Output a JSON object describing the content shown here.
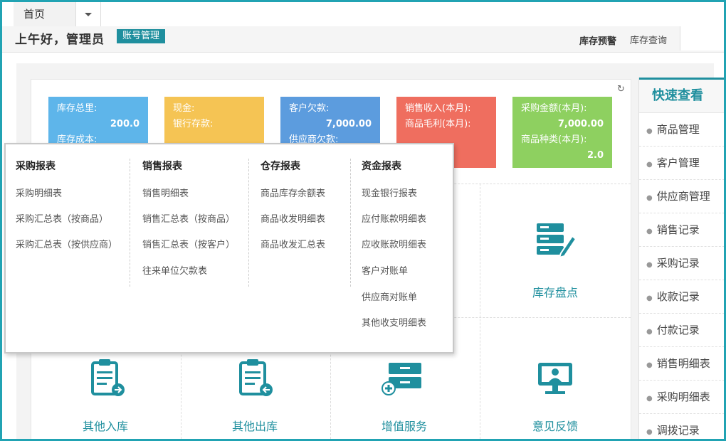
{
  "tabs": {
    "home": "首页"
  },
  "header": {
    "greeting": "上午好，管理员",
    "account_button": "账号管理",
    "stock_warning": "库存预警",
    "stock_query": "库存查询"
  },
  "cards": [
    {
      "lines": [
        "库存总里:",
        "200.0",
        "库存成本:"
      ]
    },
    {
      "lines": [
        "现金:",
        "银行存款:"
      ]
    },
    {
      "lines": [
        "客户欠款:",
        "7,000.00",
        "供应商欠款:"
      ]
    },
    {
      "lines": [
        "销售收入(本月):",
        "商品毛利(本月):"
      ]
    },
    {
      "lines": [
        "采购金额(本月):",
        "7,000.00",
        "商品种类(本月):",
        "2.0"
      ]
    }
  ],
  "tiles": {
    "stock_check": "库存盘点",
    "other_in": "其他入库",
    "other_out": "其他出库",
    "value_added": "增值服务",
    "feedback": "意见反馈"
  },
  "quick": {
    "title": "快速查看",
    "items": [
      "商品管理",
      "客户管理",
      "供应商管理",
      "销售记录",
      "采购记录",
      "收款记录",
      "付款记录",
      "销售明细表",
      "采购明细表",
      "调拨记录"
    ]
  },
  "menu": {
    "purchase": {
      "title": "采购报表",
      "items": [
        "采购明细表",
        "采购汇总表（按商品）",
        "采购汇总表（按供应商）"
      ]
    },
    "sales": {
      "title": "销售报表",
      "items": [
        "销售明细表",
        "销售汇总表（按商品）",
        "销售汇总表（按客户）",
        "往来单位欠款表"
      ]
    },
    "warehouse": {
      "title": "仓存报表",
      "items": [
        "商品库存余额表",
        "商品收发明细表",
        "商品收发汇总表"
      ]
    },
    "funds": {
      "title": "资金报表",
      "items": [
        "现金银行报表",
        "应付账款明细表",
        "应收账款明细表",
        "客户对账单",
        "供应商对账单",
        "其他收支明细表"
      ]
    }
  },
  "colors": {
    "accent": "#1f8f9e",
    "frame": "#21a3b3"
  },
  "icons": [
    "caret-down-icon",
    "refresh-icon",
    "server-edit-icon",
    "clipboard-in-icon",
    "clipboard-out-icon",
    "cabinet-add-icon",
    "monitor-user-icon"
  ]
}
